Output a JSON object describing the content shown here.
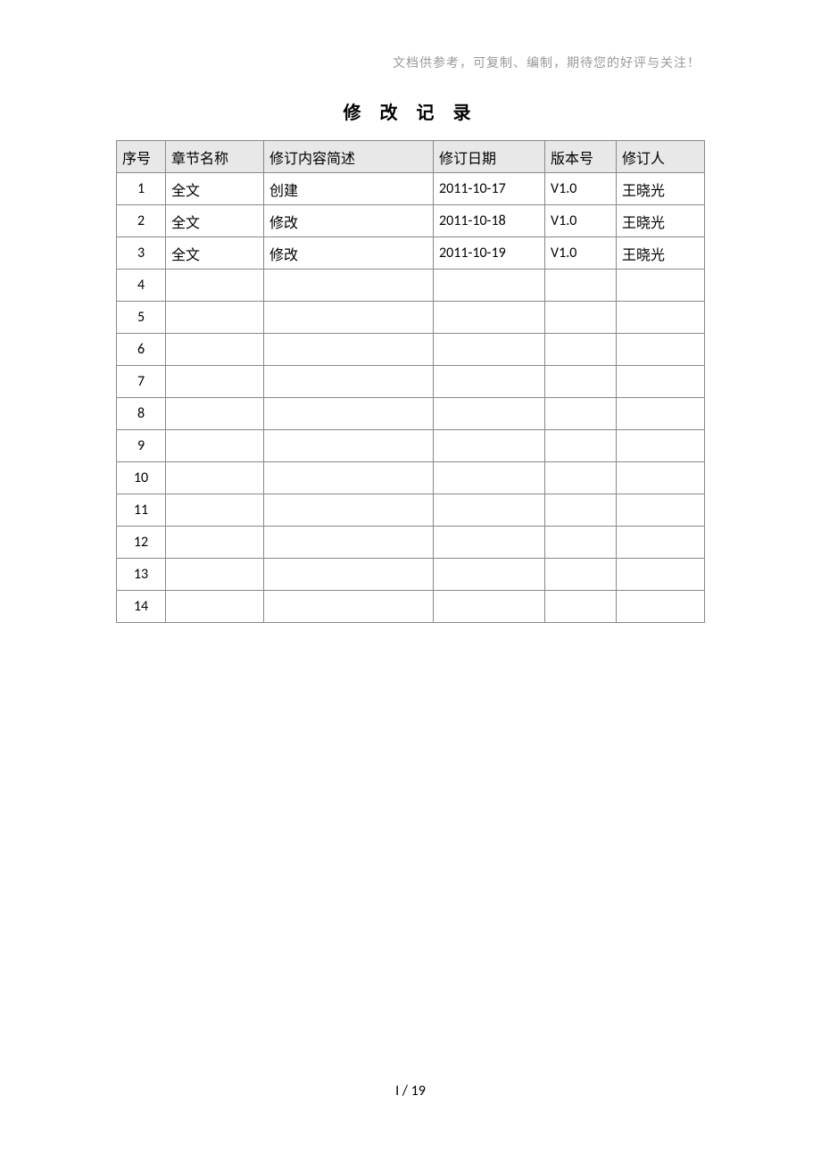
{
  "header_note": "文档供参考，可复制、编制，期待您的好评与关注！",
  "title": "修 改 记 录",
  "table": {
    "headers": {
      "seq": "序号",
      "chapter": "章节名称",
      "desc": "修订内容简述",
      "date": "修订日期",
      "version": "版本号",
      "author": "修订人"
    },
    "rows": [
      {
        "seq": "1",
        "chapter": "全文",
        "desc": "创建",
        "date": "2011-10-17",
        "version": "V1.0",
        "author": "王晓光"
      },
      {
        "seq": "2",
        "chapter": "全文",
        "desc": "修改",
        "date": "2011-10-18",
        "version": "V1.0",
        "author": "王晓光"
      },
      {
        "seq": "3",
        "chapter": "全文",
        "desc": "修改",
        "date": "2011-10-19",
        "version": "V1.0",
        "author": "王晓光"
      },
      {
        "seq": "4",
        "chapter": "",
        "desc": "",
        "date": "",
        "version": "",
        "author": ""
      },
      {
        "seq": "5",
        "chapter": "",
        "desc": "",
        "date": "",
        "version": "",
        "author": ""
      },
      {
        "seq": "6",
        "chapter": "",
        "desc": "",
        "date": "",
        "version": "",
        "author": ""
      },
      {
        "seq": "7",
        "chapter": "",
        "desc": "",
        "date": "",
        "version": "",
        "author": ""
      },
      {
        "seq": "8",
        "chapter": "",
        "desc": "",
        "date": "",
        "version": "",
        "author": ""
      },
      {
        "seq": "9",
        "chapter": "",
        "desc": "",
        "date": "",
        "version": "",
        "author": ""
      },
      {
        "seq": "10",
        "chapter": "",
        "desc": "",
        "date": "",
        "version": "",
        "author": ""
      },
      {
        "seq": "11",
        "chapter": "",
        "desc": "",
        "date": "",
        "version": "",
        "author": ""
      },
      {
        "seq": "12",
        "chapter": "",
        "desc": "",
        "date": "",
        "version": "",
        "author": ""
      },
      {
        "seq": "13",
        "chapter": "",
        "desc": "",
        "date": "",
        "version": "",
        "author": ""
      },
      {
        "seq": "14",
        "chapter": "",
        "desc": "",
        "date": "",
        "version": "",
        "author": ""
      }
    ]
  },
  "footer": "I / 19"
}
